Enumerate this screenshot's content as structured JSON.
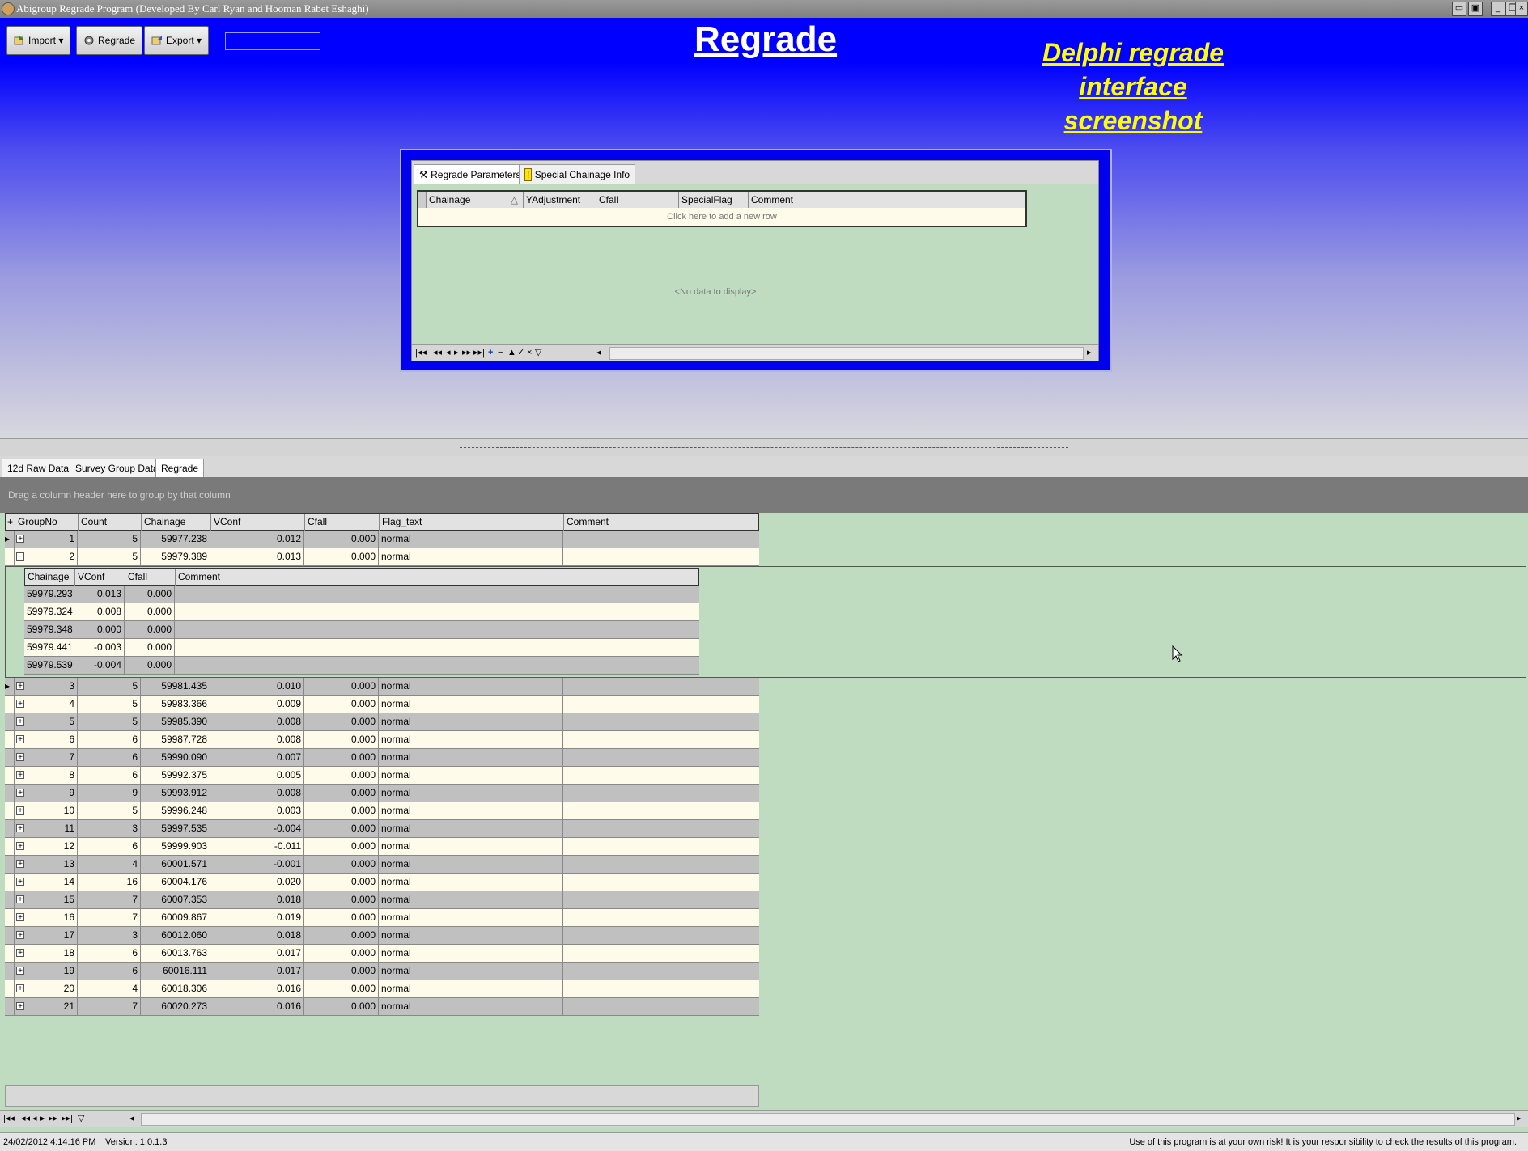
{
  "window": {
    "title": "Abigroup Regrade Program (Developed By Carl Ryan and Hooman Rabet Eshaghi)",
    "controls": [
      "minimize",
      "restore",
      "close"
    ]
  },
  "toolbar": {
    "import_label": "Import",
    "regrade_label": "Regrade",
    "export_label": "Export",
    "input_value": ""
  },
  "header": {
    "title": "Regrade",
    "note": "Delphi regrade interface screenshot"
  },
  "params": {
    "tabs": [
      "Regrade Parameters",
      "Special Chainage Info"
    ],
    "columns": [
      "Chainage",
      "YAdjustment",
      "Cfall",
      "SpecialFlag",
      "Comment"
    ],
    "new_row_text": "Click here to add a new row",
    "empty_text": "<No data to display>"
  },
  "bottom_tabs": [
    "12d Raw Data",
    "Survey Group Data",
    "Regrade"
  ],
  "group_hint": "Drag a column header here to group by that column",
  "grid": {
    "columns": [
      "GroupNo",
      "Count",
      "Chainage",
      "VConf",
      "Cfall",
      "Flag_text",
      "Comment"
    ],
    "rows_top": [
      {
        "group": "1",
        "count": "5",
        "chainage": "59977.238",
        "vconf": "0.012",
        "cfall": "0.000",
        "flag": "normal",
        "comment": ""
      },
      {
        "group": "2",
        "count": "5",
        "chainage": "59979.389",
        "vconf": "0.013",
        "cfall": "0.000",
        "flag": "normal",
        "comment": ""
      }
    ],
    "detail_columns": [
      "Chainage",
      "VConf",
      "Cfall",
      "Comment"
    ],
    "detail_rows": [
      {
        "chainage": "59979.293",
        "vconf": "0.013",
        "cfall": "0.000",
        "comment": ""
      },
      {
        "chainage": "59979.324",
        "vconf": "0.008",
        "cfall": "0.000",
        "comment": ""
      },
      {
        "chainage": "59979.348",
        "vconf": "0.000",
        "cfall": "0.000",
        "comment": ""
      },
      {
        "chainage": "59979.441",
        "vconf": "-0.003",
        "cfall": "0.000",
        "comment": ""
      },
      {
        "chainage": "59979.539",
        "vconf": "-0.004",
        "cfall": "0.000",
        "comment": ""
      }
    ],
    "rows_bottom": [
      {
        "group": "3",
        "count": "5",
        "chainage": "59981.435",
        "vconf": "0.010",
        "cfall": "0.000",
        "flag": "normal",
        "comment": ""
      },
      {
        "group": "4",
        "count": "5",
        "chainage": "59983.366",
        "vconf": "0.009",
        "cfall": "0.000",
        "flag": "normal",
        "comment": ""
      },
      {
        "group": "5",
        "count": "5",
        "chainage": "59985.390",
        "vconf": "0.008",
        "cfall": "0.000",
        "flag": "normal",
        "comment": ""
      },
      {
        "group": "6",
        "count": "6",
        "chainage": "59987.728",
        "vconf": "0.008",
        "cfall": "0.000",
        "flag": "normal",
        "comment": ""
      },
      {
        "group": "7",
        "count": "6",
        "chainage": "59990.090",
        "vconf": "0.007",
        "cfall": "0.000",
        "flag": "normal",
        "comment": ""
      },
      {
        "group": "8",
        "count": "6",
        "chainage": "59992.375",
        "vconf": "0.005",
        "cfall": "0.000",
        "flag": "normal",
        "comment": ""
      },
      {
        "group": "9",
        "count": "9",
        "chainage": "59993.912",
        "vconf": "0.008",
        "cfall": "0.000",
        "flag": "normal",
        "comment": ""
      },
      {
        "group": "10",
        "count": "5",
        "chainage": "59996.248",
        "vconf": "0.003",
        "cfall": "0.000",
        "flag": "normal",
        "comment": ""
      },
      {
        "group": "11",
        "count": "3",
        "chainage": "59997.535",
        "vconf": "-0.004",
        "cfall": "0.000",
        "flag": "normal",
        "comment": ""
      },
      {
        "group": "12",
        "count": "6",
        "chainage": "59999.903",
        "vconf": "-0.011",
        "cfall": "0.000",
        "flag": "normal",
        "comment": ""
      },
      {
        "group": "13",
        "count": "4",
        "chainage": "60001.571",
        "vconf": "-0.001",
        "cfall": "0.000",
        "flag": "normal",
        "comment": ""
      },
      {
        "group": "14",
        "count": "16",
        "chainage": "60004.176",
        "vconf": "0.020",
        "cfall": "0.000",
        "flag": "normal",
        "comment": ""
      },
      {
        "group": "15",
        "count": "7",
        "chainage": "60007.353",
        "vconf": "0.018",
        "cfall": "0.000",
        "flag": "normal",
        "comment": ""
      },
      {
        "group": "16",
        "count": "7",
        "chainage": "60009.867",
        "vconf": "0.019",
        "cfall": "0.000",
        "flag": "normal",
        "comment": ""
      },
      {
        "group": "17",
        "count": "3",
        "chainage": "60012.060",
        "vconf": "0.018",
        "cfall": "0.000",
        "flag": "normal",
        "comment": ""
      },
      {
        "group": "18",
        "count": "6",
        "chainage": "60013.763",
        "vconf": "0.017",
        "cfall": "0.000",
        "flag": "normal",
        "comment": ""
      },
      {
        "group": "19",
        "count": "6",
        "chainage": "60016.111",
        "vconf": "0.017",
        "cfall": "0.000",
        "flag": "normal",
        "comment": ""
      },
      {
        "group": "20",
        "count": "4",
        "chainage": "60018.306",
        "vconf": "0.016",
        "cfall": "0.000",
        "flag": "normal",
        "comment": ""
      },
      {
        "group": "21",
        "count": "7",
        "chainage": "60020.273",
        "vconf": "0.016",
        "cfall": "0.000",
        "flag": "normal",
        "comment": ""
      }
    ]
  },
  "status": {
    "datetime": "24/02/2012 4:14:16 PM",
    "version": "Version: 1.0.1.3",
    "disclaimer": "Use of this program is at your own risk! It is your responsibility to check the results of this program."
  },
  "colors": {
    "header_blue": "#0000ff",
    "note_yellow": "#ffff00",
    "grid_empty_green": "#c0dcc0"
  }
}
